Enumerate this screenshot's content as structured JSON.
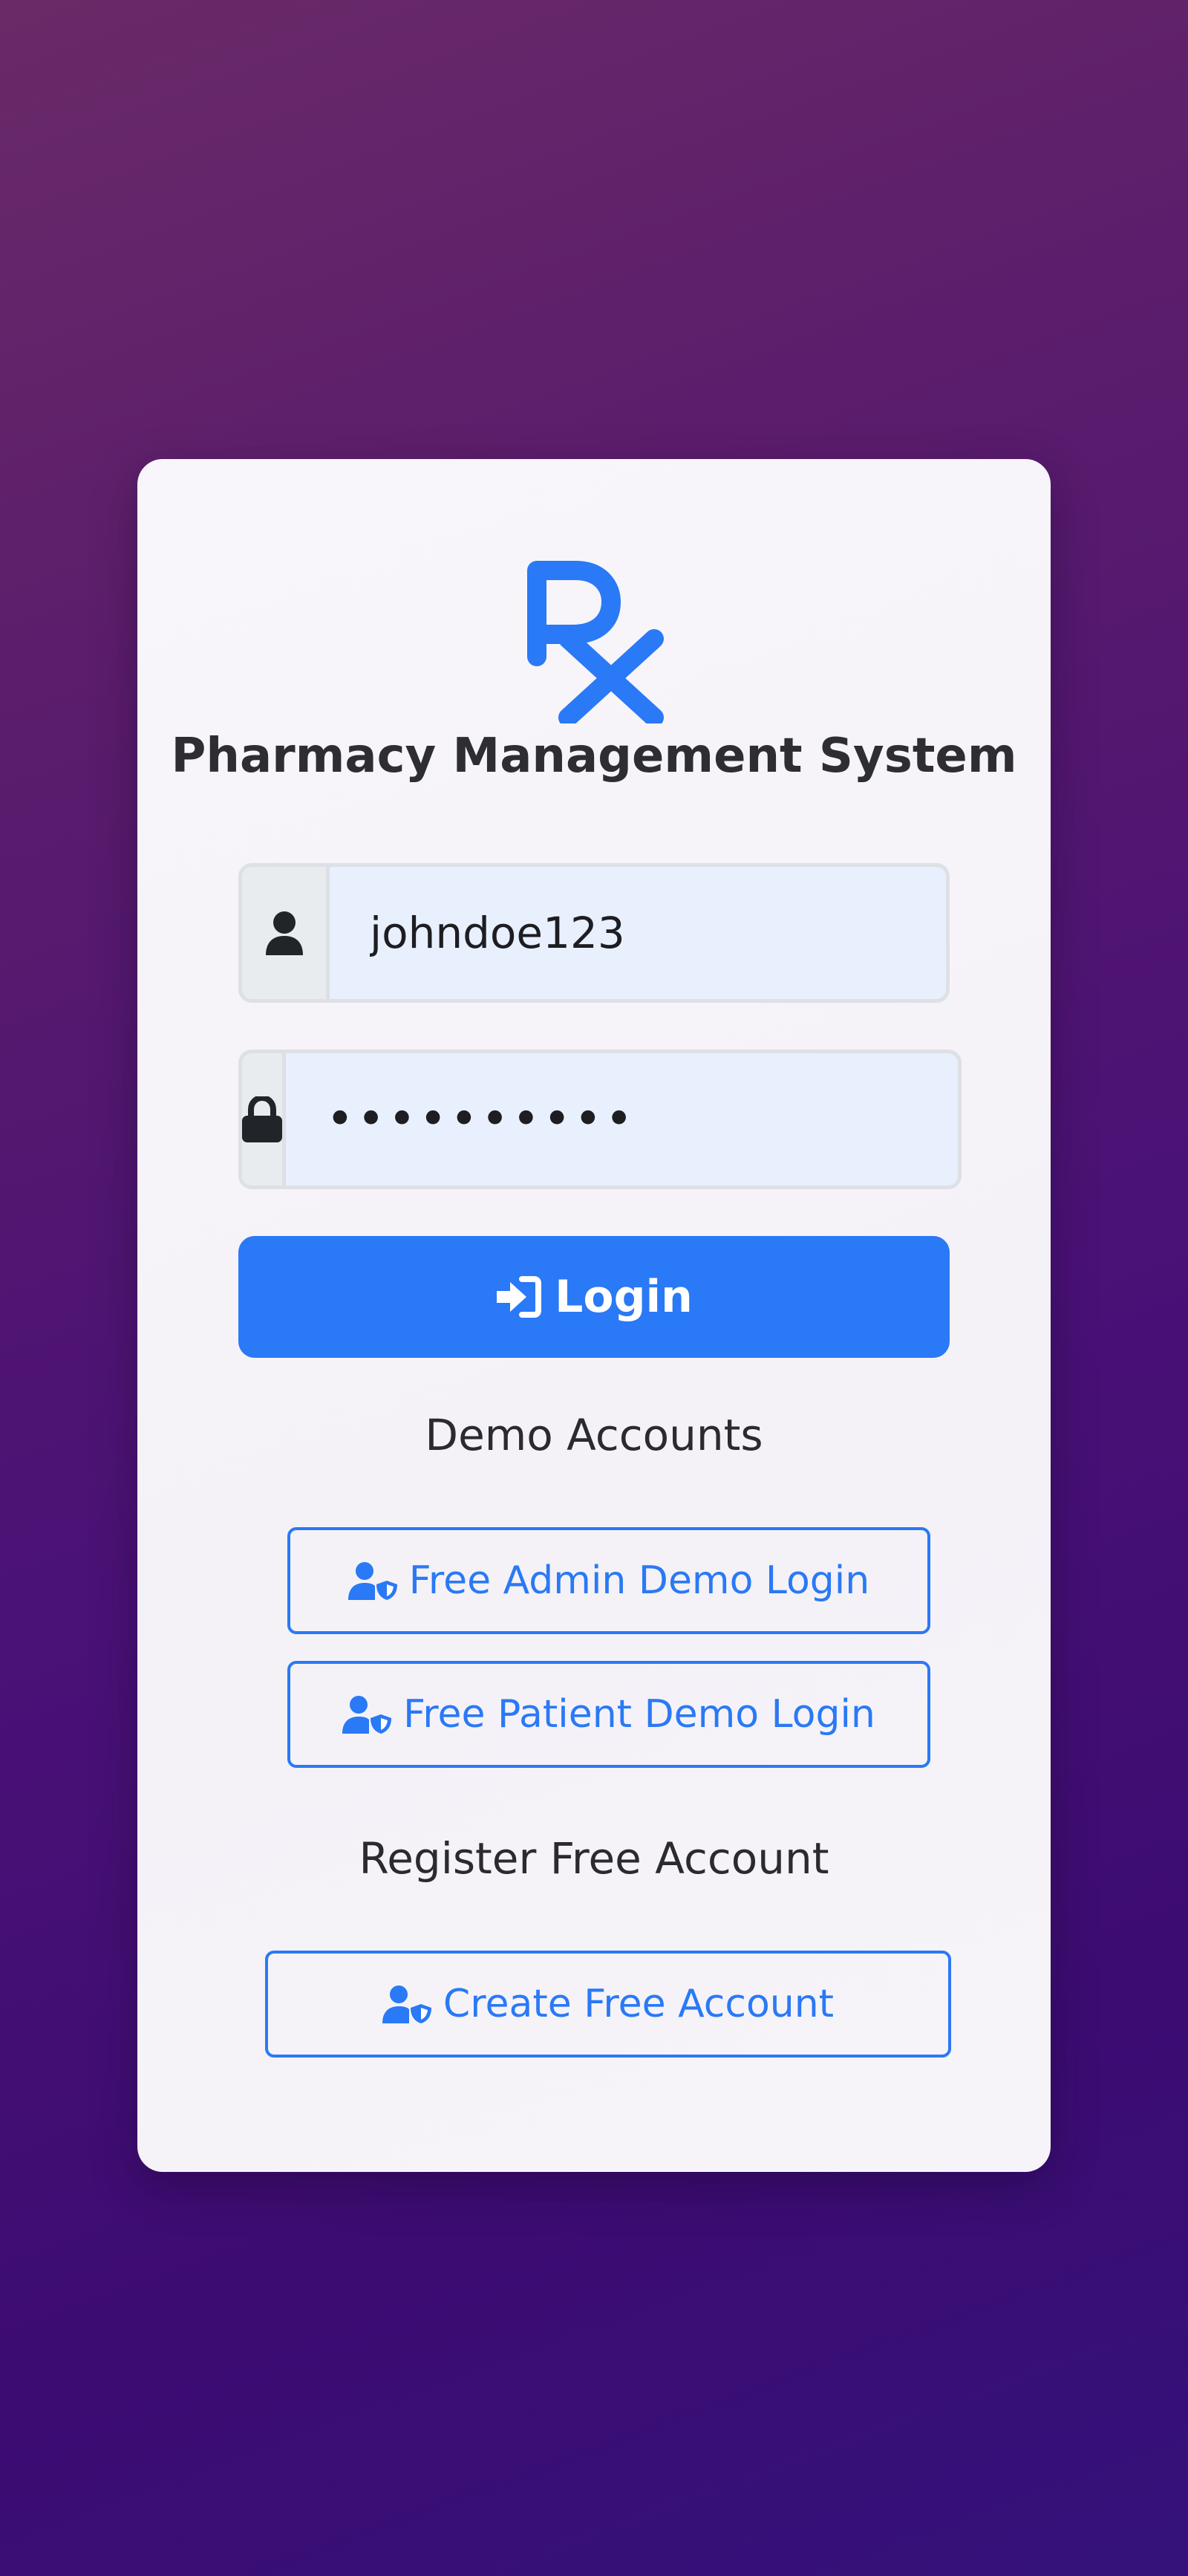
{
  "app": {
    "title": "Pharmacy Management System",
    "logo_icon": "rx-icon",
    "accent_color": "#2a79f6"
  },
  "login_form": {
    "username": {
      "icon": "user-icon",
      "value": "johndoe123"
    },
    "password": {
      "icon": "lock-icon",
      "value": "••••••••••"
    },
    "submit": {
      "icon": "sign-in-icon",
      "label": "Login"
    }
  },
  "demo": {
    "heading": "Demo Accounts",
    "admin_button": {
      "icon": "user-shield-icon",
      "label": "Free Admin Demo Login"
    },
    "patient_button": {
      "icon": "user-shield-icon",
      "label": "Free Patient Demo Login"
    }
  },
  "register": {
    "heading": "Register Free Account",
    "create_button": {
      "icon": "user-shield-icon",
      "label": "Create Free Account"
    }
  }
}
